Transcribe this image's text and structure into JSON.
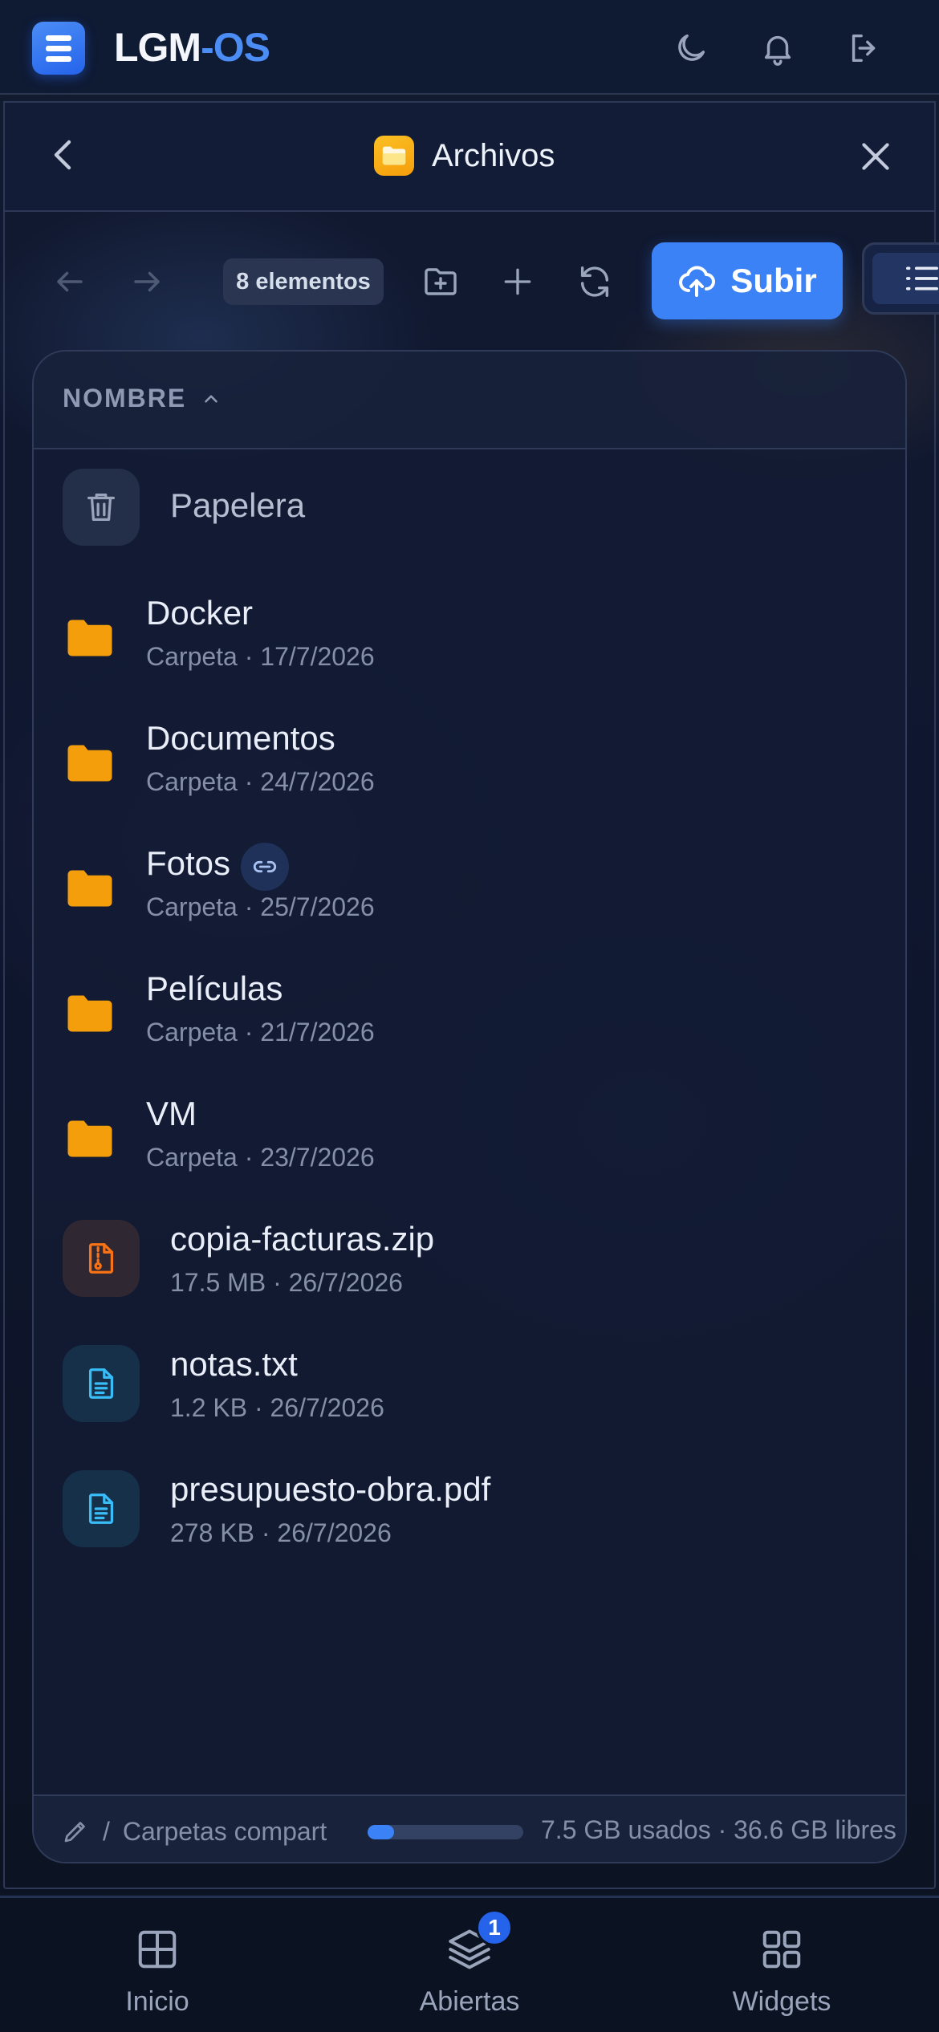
{
  "app": {
    "brand_part1": "LGM",
    "brand_part2": "-OS"
  },
  "window": {
    "title": "Archivos"
  },
  "toolbar": {
    "count_label": "8 elementos",
    "upload_label": "Subir"
  },
  "list": {
    "column_header": "NOMBRE",
    "trash_label": "Papelera",
    "items": [
      {
        "name": "Docker",
        "meta": "Carpeta · 17/7/2026",
        "type": "folder"
      },
      {
        "name": "Documentos",
        "meta": "Carpeta · 24/7/2026",
        "type": "folder"
      },
      {
        "name": "Fotos",
        "meta": "Carpeta · 25/7/2026",
        "type": "folder",
        "shared": true
      },
      {
        "name": "Películas",
        "meta": "Carpeta · 21/7/2026",
        "type": "folder"
      },
      {
        "name": "VM",
        "meta": "Carpeta · 23/7/2026",
        "type": "folder"
      },
      {
        "name": "copia-facturas.zip",
        "meta": "17.5 MB · 26/7/2026",
        "type": "archive"
      },
      {
        "name": "notas.txt",
        "meta": "1.2 KB · 26/7/2026",
        "type": "document"
      },
      {
        "name": "presupuesto-obra.pdf",
        "meta": "278 KB · 26/7/2026",
        "type": "document"
      }
    ]
  },
  "footer": {
    "path_root": "/",
    "path_crumb": "Carpetas compartidas",
    "usage_fraction": 0.17,
    "usage_text": "7.5 GB usados · 36.6 GB libres"
  },
  "nav": {
    "home": "Inicio",
    "open": "Abiertas",
    "open_badge": "1",
    "widgets": "Widgets"
  },
  "colors": {
    "accent": "#3b82f6",
    "folder": "#f59e0b",
    "archive": "#f97316",
    "document": "#38bdf8"
  }
}
